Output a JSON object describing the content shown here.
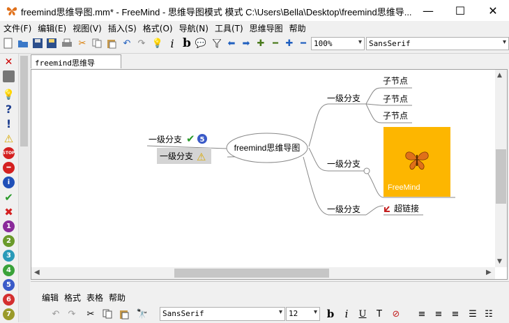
{
  "window": {
    "title": "freemind思维导图.mm* - FreeMind - 思维导图模式 模式 C:\\Users\\Bella\\Desktop\\freemind思维导...",
    "minimize": "—",
    "maximize": "☐",
    "close": "✕"
  },
  "menubar": [
    "文件(F)",
    "编辑(E)",
    "视图(V)",
    "插入(S)",
    "格式(O)",
    "导航(N)",
    "工具(T)",
    "思维导图",
    "帮助"
  ],
  "toolbar": {
    "zoom": "100%",
    "font": "SansSerif",
    "italic": "i",
    "bold": "b"
  },
  "tab": {
    "label": "freemind思维导图.mm*"
  },
  "mindmap": {
    "root": "freemind思维导图",
    "left_nodes": [
      "一级分支",
      "一级分支"
    ],
    "right_nodes": [
      "一级分支",
      "一级分支",
      "一级分支"
    ],
    "sub_nodes": [
      "子节点",
      "子节点",
      "子节点"
    ],
    "image_caption": "FreeMind",
    "link_node": "超链接",
    "badge_number": "5"
  },
  "leftbar_numbers": [
    "1",
    "2",
    "3",
    "4",
    "5",
    "6",
    "7"
  ],
  "editor": {
    "menu": [
      "编辑",
      "格式",
      "表格",
      "帮助"
    ],
    "font": "SansSerif",
    "size": "12",
    "bold": "b",
    "italic": "i",
    "underline": "U"
  },
  "colors": {
    "image_bg": "#fdb600",
    "accent_blue": "#1f5fbf"
  }
}
